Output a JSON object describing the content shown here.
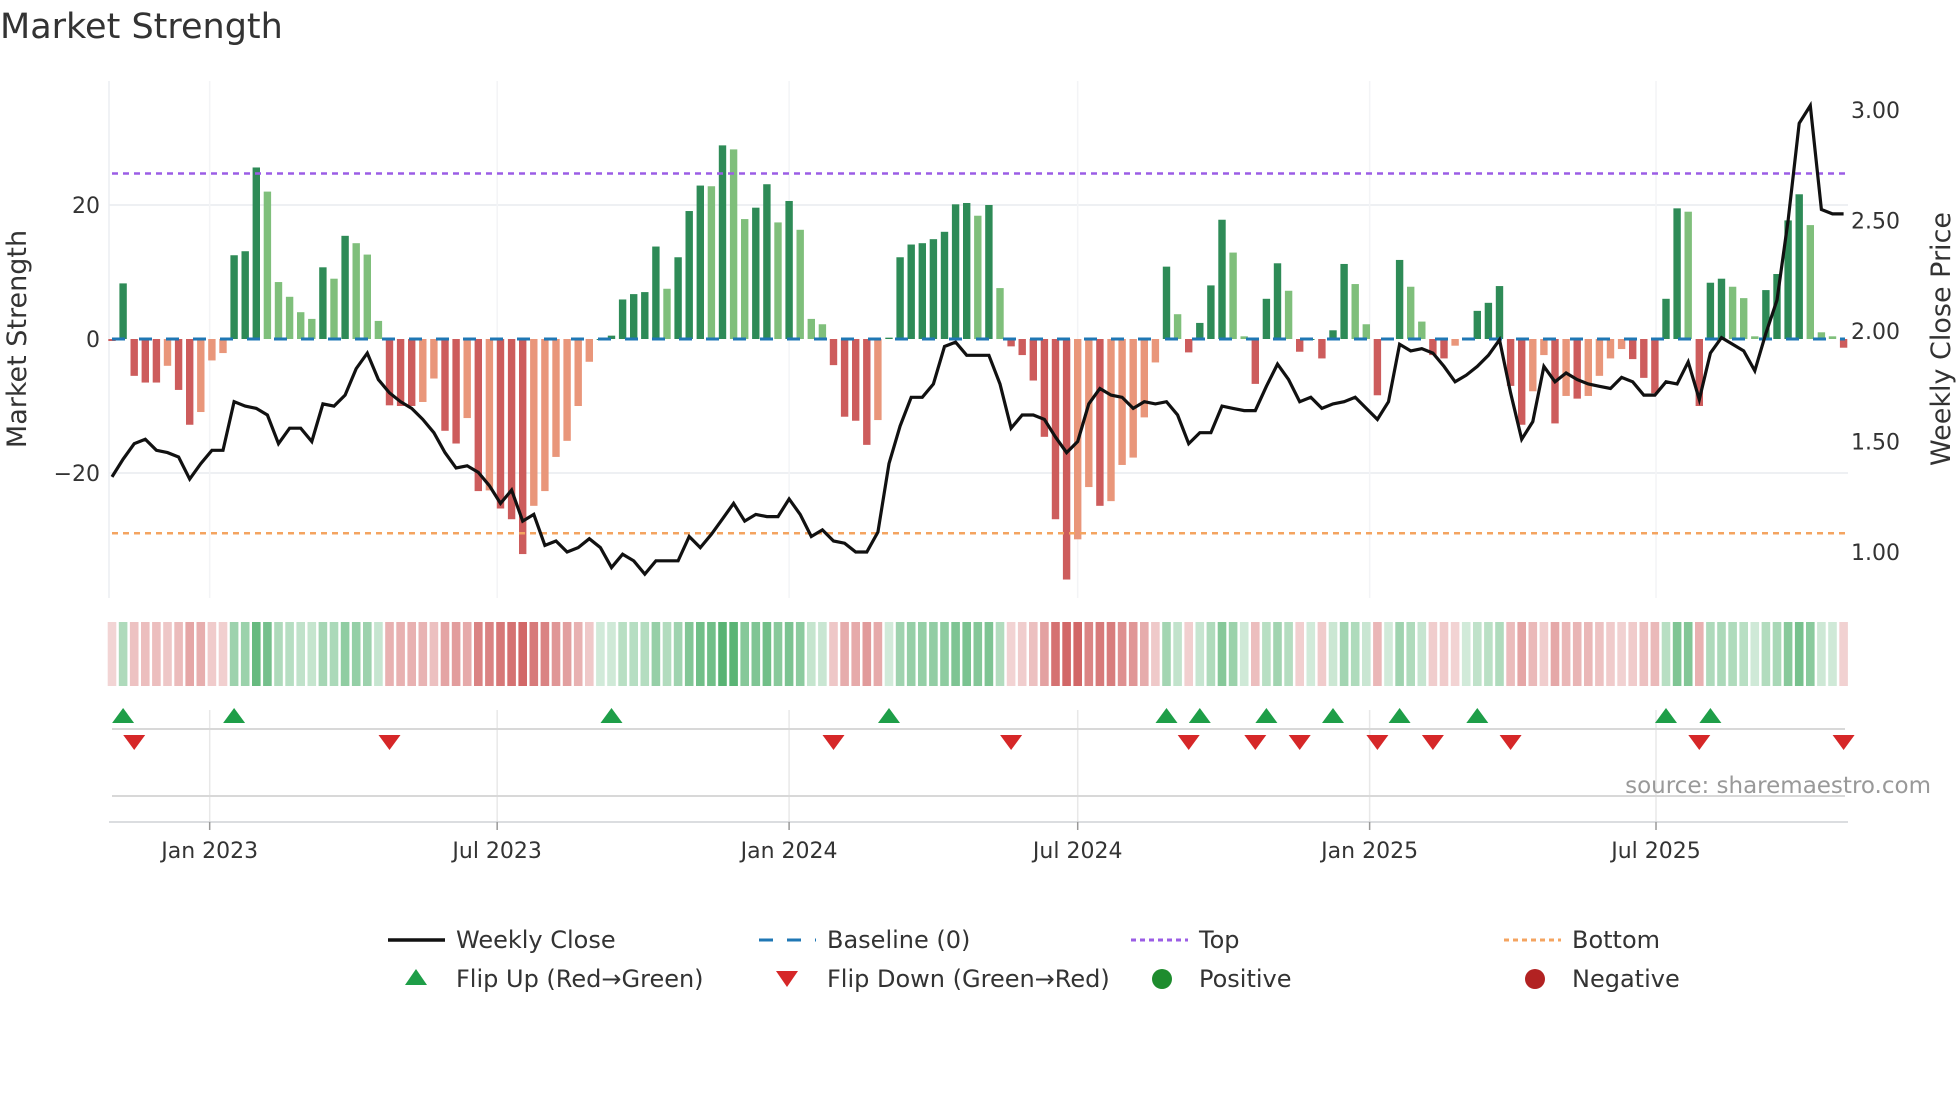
{
  "title": "Market Strength",
  "source": "source: sharemaestro.com",
  "colors": {
    "pos_strong": "#2e8b57",
    "pos_weak": "#7fbf7b",
    "neg_strong": "#cd5c5c",
    "neg_weak": "#e9967a",
    "baseline": "#1f77b4",
    "top": "#9b5de5",
    "bottom": "#f4a460",
    "close": "#111111",
    "flip_up": "#1e9e48",
    "flip_down": "#d62728",
    "positive": "#1e8c2e",
    "negative": "#b22222"
  },
  "chart_data": {
    "type": "bar+line",
    "title": "Market Strength",
    "ylabel": "Market Strength",
    "y2label": "Weekly Close Price",
    "ylim": [
      -38,
      39
    ],
    "y2lim": [
      0.78,
      3.2
    ],
    "yticks": [
      {
        "v": 20,
        "label": "20"
      },
      {
        "v": 0,
        "label": "0"
      },
      {
        "v": -20,
        "label": "−20"
      }
    ],
    "y2ticks": [
      {
        "v": 3.0,
        "label": "3.00"
      },
      {
        "v": 2.5,
        "label": "2.50"
      },
      {
        "v": 2.0,
        "label": "2.00"
      },
      {
        "v": 1.5,
        "label": "1.50"
      },
      {
        "v": 1.0,
        "label": "1.00"
      }
    ],
    "xticks": [
      {
        "week": 9.8,
        "label": "Jan 2023"
      },
      {
        "week": 35.7,
        "label": "Jul 2023"
      },
      {
        "week": 62,
        "label": "Jan 2024"
      },
      {
        "week": 88,
        "label": "Jul 2024"
      },
      {
        "week": 114.3,
        "label": "Jan 2025"
      },
      {
        "week": 140.1,
        "label": "Jul 2025"
      }
    ],
    "top_level": 24.7,
    "bottom_level": -29.0,
    "baseline": 0,
    "strength": [
      -0.3,
      8.3,
      -5.5,
      -6.5,
      -6.5,
      -4,
      -7.6,
      -12.8,
      -10.9,
      -3.2,
      -2.1,
      12.5,
      13.1,
      25.6,
      22,
      8.5,
      6.3,
      4,
      3,
      10.7,
      9,
      15.4,
      14.3,
      12.6,
      2.7,
      -9.9,
      -10,
      -10,
      -9.4,
      -5.9,
      -13.7,
      -15.6,
      -11.8,
      -22.7,
      -22.6,
      -25.3,
      -26.9,
      -32.1,
      -24.9,
      -22.7,
      -17.6,
      -15.2,
      -10,
      -3.4,
      0,
      0.5,
      5.9,
      6.7,
      7,
      13.8,
      7.5,
      12.2,
      19.1,
      22.9,
      22.8,
      28.9,
      28.3,
      17.9,
      19.6,
      23.1,
      17.4,
      20.6,
      16.3,
      3,
      2.2,
      -3.9,
      -11.6,
      -12.2,
      -15.8,
      -12.1,
      0.2,
      12.2,
      14.1,
      14.3,
      14.9,
      16,
      20.1,
      20.3,
      18.4,
      20,
      7.6,
      -1.1,
      -2.4,
      -6.2,
      -14.6,
      -26.9,
      -35.9,
      -29.9,
      -22.1,
      -24.9,
      -24.2,
      -18.8,
      -17.7,
      -11.7,
      -3.5,
      10.8,
      3.7,
      -2,
      2.4,
      8,
      17.8,
      12.9,
      0.4,
      -6.7,
      6,
      11.3,
      7.2,
      -1.9,
      0,
      -2.9,
      1.3,
      11.2,
      8.2,
      2.2,
      -8.4,
      0,
      11.8,
      7.8,
      2.6,
      -2.4,
      -2.9,
      -1,
      0,
      4.2,
      5.4,
      7.9,
      -7,
      -12.8,
      -7.8,
      -2.4,
      -12.6,
      -8.5,
      -8.9,
      -8.5,
      -5.5,
      -2.9,
      -1.5,
      -3,
      -5.8,
      -8.1,
      6,
      19.5,
      19,
      -10,
      8.4,
      9,
      7.8,
      6.1,
      0.4,
      7.3,
      9.7,
      17.7,
      21.6,
      17,
      1,
      0.4,
      -1.3
    ],
    "close": [
      1.34,
      1.42,
      1.49,
      1.51,
      1.46,
      1.45,
      1.43,
      1.33,
      1.4,
      1.46,
      1.46,
      1.68,
      1.66,
      1.65,
      1.62,
      1.49,
      1.56,
      1.56,
      1.5,
      1.67,
      1.66,
      1.71,
      1.83,
      1.9,
      1.78,
      1.72,
      1.68,
      1.65,
      1.6,
      1.54,
      1.45,
      1.38,
      1.39,
      1.36,
      1.3,
      1.22,
      1.28,
      1.14,
      1.17,
      1.03,
      1.05,
      1.0,
      1.02,
      1.06,
      1.02,
      0.93,
      0.99,
      0.96,
      0.9,
      0.96,
      0.96,
      0.96,
      1.07,
      1.02,
      1.08,
      1.15,
      1.22,
      1.14,
      1.17,
      1.16,
      1.16,
      1.24,
      1.17,
      1.07,
      1.1,
      1.05,
      1.04,
      1.0,
      1.0,
      1.09,
      1.4,
      1.57,
      1.7,
      1.7,
      1.76,
      1.93,
      1.95,
      1.89,
      1.89,
      1.89,
      1.76,
      1.56,
      1.62,
      1.62,
      1.6,
      1.52,
      1.45,
      1.5,
      1.67,
      1.74,
      1.71,
      1.7,
      1.65,
      1.68,
      1.67,
      1.68,
      1.62,
      1.49,
      1.54,
      1.54,
      1.66,
      1.65,
      1.64,
      1.64,
      1.75,
      1.85,
      1.78,
      1.68,
      1.7,
      1.65,
      1.67,
      1.68,
      1.7,
      1.65,
      1.6,
      1.68,
      1.94,
      1.91,
      1.92,
      1.9,
      1.84,
      1.77,
      1.8,
      1.84,
      1.89,
      1.96,
      1.72,
      1.51,
      1.59,
      1.84,
      1.77,
      1.81,
      1.78,
      1.76,
      1.75,
      1.74,
      1.79,
      1.77,
      1.71,
      1.71,
      1.77,
      1.76,
      1.86,
      1.69,
      1.9,
      1.97,
      1.94,
      1.91,
      1.82,
      1.99,
      2.14,
      2.5,
      2.94,
      3.02,
      2.55,
      2.53,
      2.53
    ],
    "flip_up_weeks": [
      2,
      12,
      46,
      71,
      96,
      99,
      105,
      111,
      117,
      124,
      141,
      145
    ],
    "flip_down_weeks": [
      3,
      26,
      66,
      82,
      98,
      104,
      108,
      115,
      120,
      127,
      144,
      157
    ],
    "grid": true,
    "legend_placement": "bottom",
    "legend": [
      {
        "key": "close",
        "label": "Weekly Close"
      },
      {
        "key": "baseline",
        "label": "Baseline (0)"
      },
      {
        "key": "top",
        "label": "Top"
      },
      {
        "key": "bottom",
        "label": "Bottom"
      },
      {
        "key": "flip_up",
        "label": "Flip Up (Red→Green)"
      },
      {
        "key": "flip_down",
        "label": "Flip Down (Green→Red)"
      },
      {
        "key": "positive",
        "label": "Positive"
      },
      {
        "key": "negative",
        "label": "Negative"
      }
    ]
  }
}
